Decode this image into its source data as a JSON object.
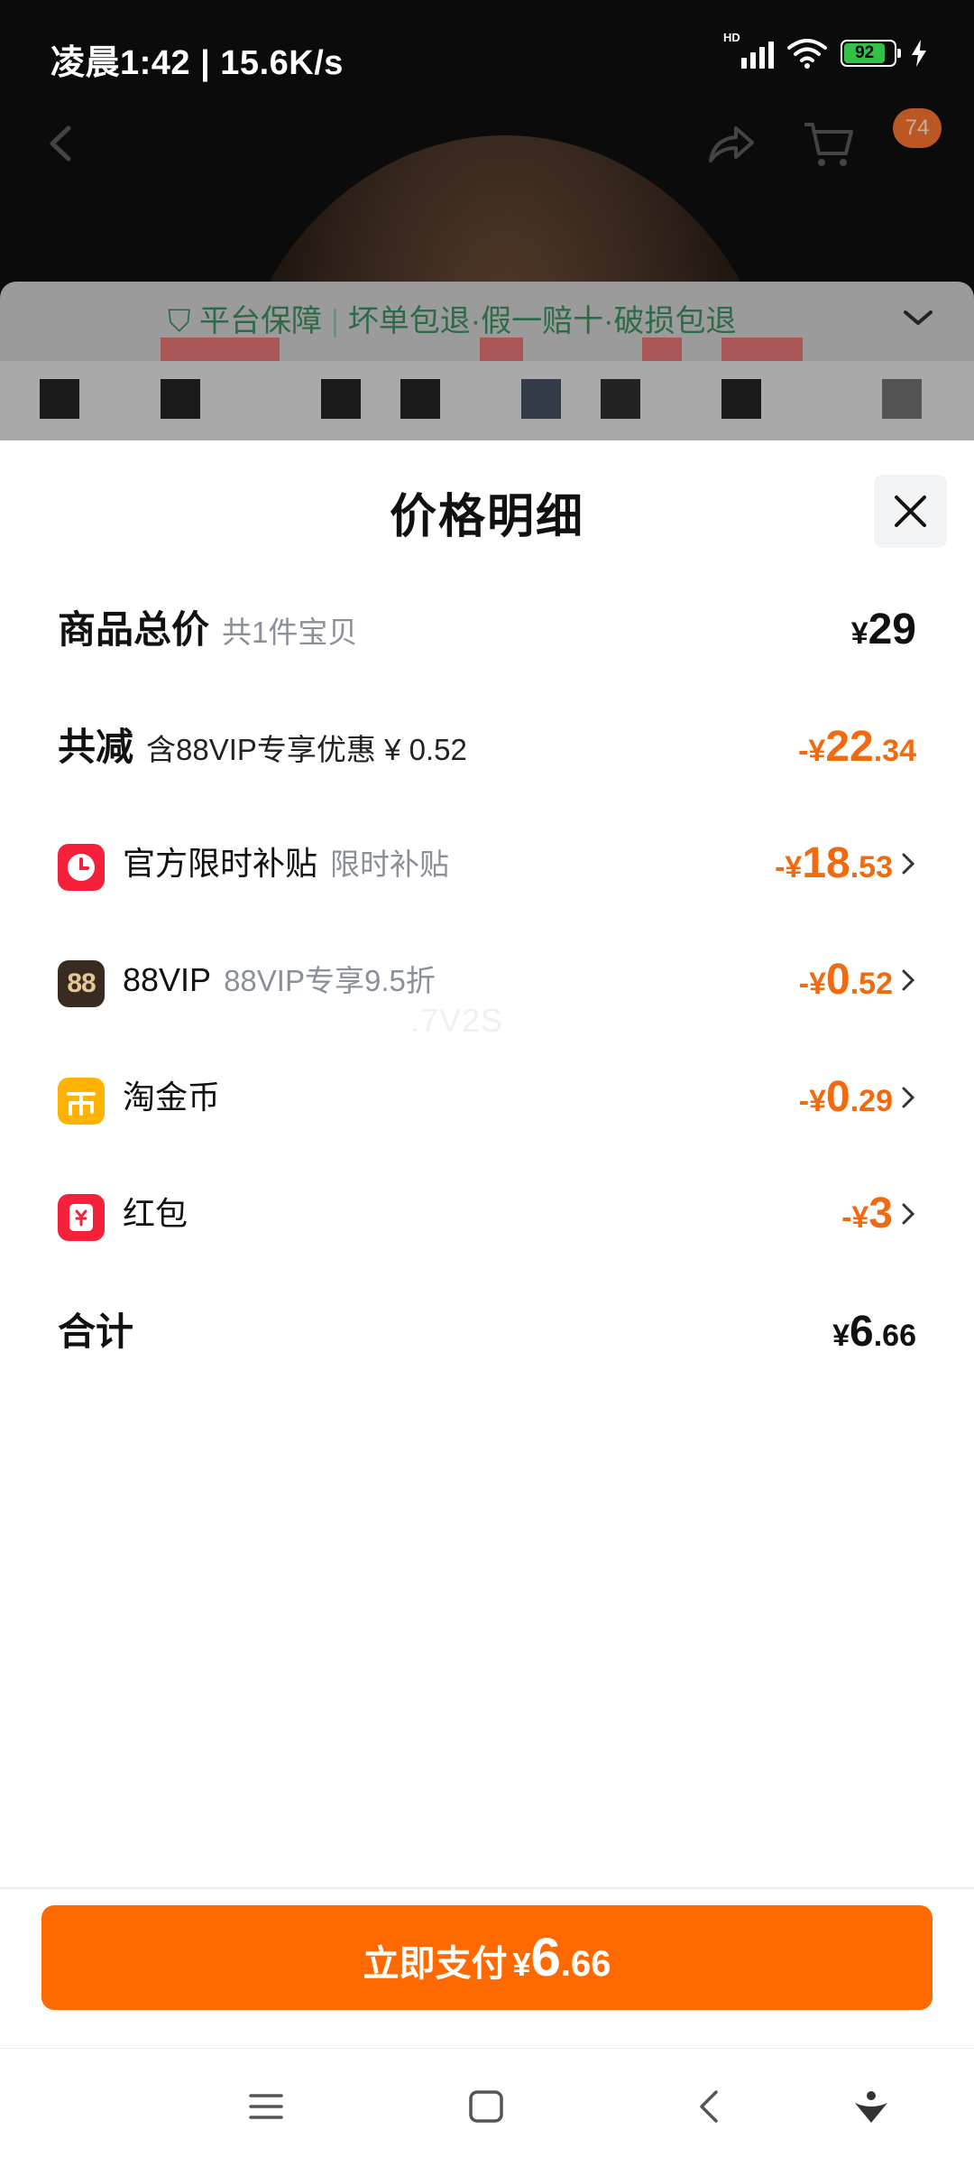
{
  "status_bar": {
    "time_speed": "凌晨1:42 | 15.6K/s",
    "network": "HD",
    "battery": "92"
  },
  "background": {
    "cart_badge": "74",
    "guarantee_label": "平台保障",
    "guarantee_items": "坏单包退·假一赔十·破损包退"
  },
  "sheet": {
    "title": "价格明细",
    "rows": [
      {
        "name": "商品总价",
        "sub": "共1件宝贝",
        "yen": "¥",
        "int": "29",
        "dec": ""
      },
      {
        "name": "共减",
        "sub": "含88VIP专享优惠 ¥ 0.52",
        "yen": "-¥",
        "int": "22",
        "dec": ".34"
      },
      {
        "name": "官方限时补贴",
        "sub": "限时补贴",
        "yen": "-¥",
        "int": "18",
        "dec": ".53"
      },
      {
        "name": "88VIP",
        "sub": "88VIP专享9.5折",
        "yen": "-¥",
        "int": "0",
        "dec": ".52"
      },
      {
        "name": "淘金币",
        "sub": "",
        "yen": "-¥",
        "int": "0",
        "dec": ".29"
      },
      {
        "name": "红包",
        "sub": "",
        "yen": "-¥",
        "int": "3",
        "dec": ""
      },
      {
        "name": "合计",
        "sub": "",
        "yen": "¥",
        "int": "6",
        "dec": ".66"
      }
    ],
    "vip_icon_text": "88",
    "watermark": ".7V2S"
  },
  "pay_button": {
    "label": "立即支付",
    "yen": "¥",
    "int": "6",
    "dec": ".66"
  },
  "colors": {
    "accent": "#ff6a00",
    "discount": "#f06a0f"
  }
}
